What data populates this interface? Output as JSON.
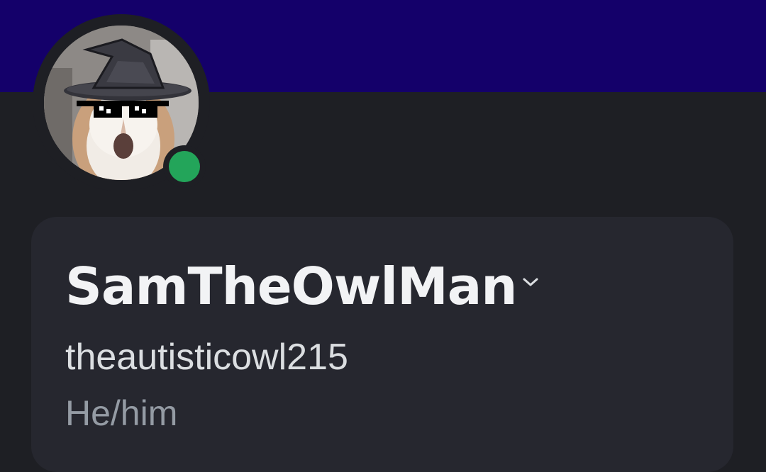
{
  "profile": {
    "display_name": "SamTheOwlMan",
    "username": "theautisticowl215",
    "pronouns": "He/him",
    "status": "online",
    "avatar_icon": "owl-with-witch-hat-and-pixel-sunglasses"
  },
  "colors": {
    "banner": "#14006a",
    "background": "#1e1f24",
    "card": "#26272f",
    "status_online": "#23a55a",
    "display_name_text": "#f2f3f5",
    "username_text": "#dbdee1",
    "pronouns_text": "#949ba4"
  },
  "icons": {
    "chevron": "chevron-down-icon",
    "status": "online-status-icon"
  }
}
